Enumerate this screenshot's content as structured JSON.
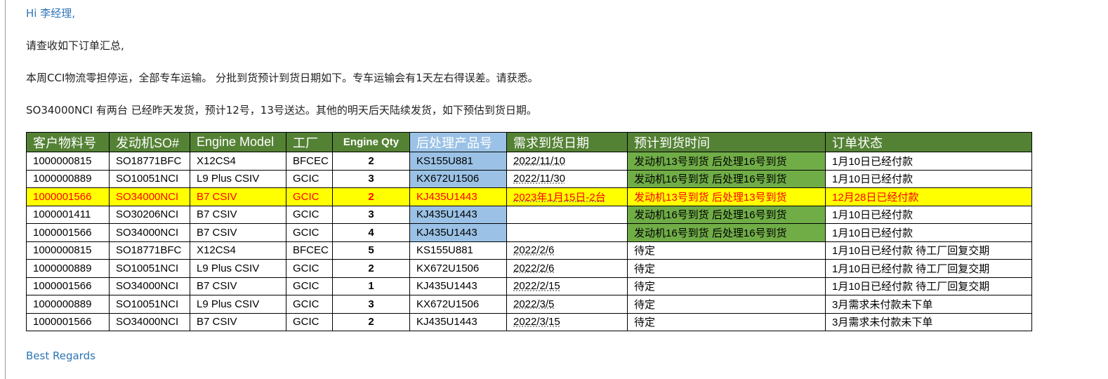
{
  "email": {
    "greeting": "Hi 李经理,",
    "intro": "请查收如下订单汇总,",
    "para1": "本周CCI物流零担停运，全部专车运输。 分批到货预计到货日期如下。专车运输会有1天左右得误差。请获悉。",
    "para2": "SO34000NCI 有两台 已经昨天发货，预计12号，13号送达。其他的明天后天陆续发货，如下预估到货日期。",
    "signature": "Best Regards"
  },
  "table": {
    "headers": [
      "客户物料号",
      "发动机SO#",
      "Engine Model",
      "工厂",
      "Engine Qty",
      "后处理产品号",
      "需求到货日期",
      "预计到货时间",
      "订单状态"
    ],
    "rows": [
      {
        "part": "1000000815",
        "so": "SO18771BFC",
        "model": "X12CS4",
        "plant": "BFCEC",
        "qty": "2",
        "pp": "KS155U881",
        "due": "2022/11/10",
        "eta": "发动机13号到货 后处理16号到货",
        "status": "1月10日已经付款"
      },
      {
        "part": "1000000889",
        "so": "SO10051NCI",
        "model": "L9 Plus CSIV",
        "plant": "GCIC",
        "qty": "3",
        "pp": "KX672U1506",
        "due": "2022/11/30",
        "eta": "发动机16号到货 后处理16号到货",
        "status": "1月10日已经付款"
      },
      {
        "part": "1000001566",
        "so": "SO34000NCI",
        "model": "B7 CSIV",
        "plant": "GCIC",
        "qty": "2",
        "pp": "KJ435U1443",
        "due": "2023年1月15日-2台",
        "eta": "发动机13号到货 后处理13号到货",
        "status": "12月28日已经付款"
      },
      {
        "part": "1000001411",
        "so": "SO30206NCI",
        "model": "B7 CSIV",
        "plant": "GCIC",
        "qty": "3",
        "pp": "KJ435U1443",
        "due": "",
        "eta": "发动机16号到货 后处理16号到货",
        "status": "1月10日已经付款"
      },
      {
        "part": "1000001566",
        "so": "SO34000NCI",
        "model": "B7 CSIV",
        "plant": "GCIC",
        "qty": "4",
        "pp": "KJ435U1443",
        "due": "",
        "eta": "发动机16号到货 后处理16号到货",
        "status": "1月10日已经付款"
      },
      {
        "part": "1000000815",
        "so": "SO18771BFC",
        "model": "X12CS4",
        "plant": "BFCEC",
        "qty": "5",
        "pp": "KS155U881",
        "due": "2022/2/6",
        "eta": "待定",
        "status": "1月10日已经付款 待工厂回复交期"
      },
      {
        "part": "1000000889",
        "so": "SO10051NCI",
        "model": "L9 Plus CSIV",
        "plant": "GCIC",
        "qty": "2",
        "pp": "KX672U1506",
        "due": "2022/2/6",
        "eta": "待定",
        "status": "1月10日已经付款 待工厂回复交期"
      },
      {
        "part": "1000001566",
        "so": "SO34000NCI",
        "model": "B7 CSIV",
        "plant": "GCIC",
        "qty": "1",
        "pp": "KJ435U1443",
        "due": "2022/2/15",
        "eta": "待定",
        "status": "1月10日已经付款 待工厂回复交期"
      },
      {
        "part": "1000000889",
        "so": "SO10051NCI",
        "model": "L9 Plus CSIV",
        "plant": "GCIC",
        "qty": "3",
        "pp": "KX672U1506",
        "due": "2022/3/5",
        "eta": "待定",
        "status": "3月需求未付款未下单"
      },
      {
        "part": "1000001566",
        "so": "SO34000NCI",
        "model": "B7 CSIV",
        "plant": "GCIC",
        "qty": "2",
        "pp": "KJ435U1443",
        "due": "2022/3/15",
        "eta": "待定",
        "status": "3月需求未付款未下单"
      }
    ]
  },
  "colors": {
    "header_green": "#548235",
    "cell_green": "#70ad47",
    "product_blue": "#9bc2e6",
    "highlight_yellow": "#ffff00",
    "highlight_red": "#ff0000",
    "link_blue": "#2e75b6"
  }
}
